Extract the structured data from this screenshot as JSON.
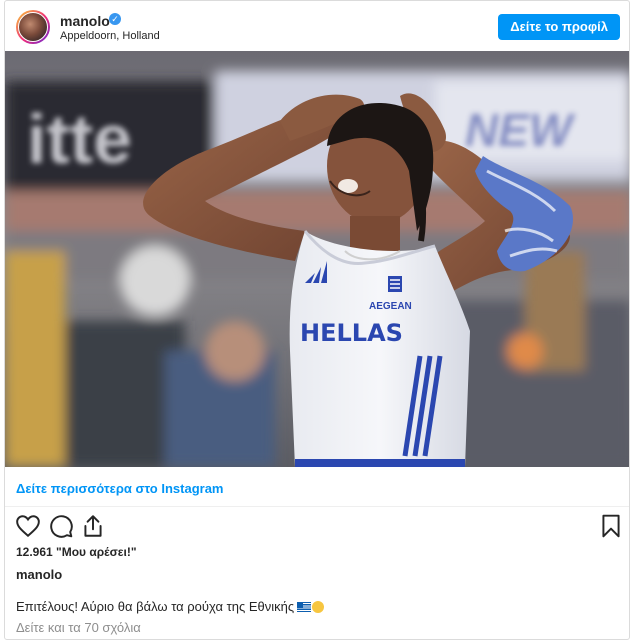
{
  "post": {
    "username": "manolo",
    "location": "Appeldoorn, Holland",
    "profile_button": "Δείτε το προφίλ",
    "see_more": "Δείτε περισσότερα στο Instagram",
    "likes": "12.961 \"Μου αρέσει!\"",
    "author": "manolo",
    "caption": "Επιτέλους! Αύριο θα βάλω τα ρούχα της Εθνικής",
    "comments_link": "Δείτε και τα 70 σχόλια"
  },
  "photo": {
    "jersey_text": "HELLAS",
    "sponsor_text": "AEGEAN",
    "banner_left": "itte",
    "banner_right": "NEW"
  },
  "icons": {
    "verified": "verified-badge-icon",
    "like": "heart-icon",
    "comment": "comment-icon",
    "share": "share-icon",
    "save": "bookmark-icon"
  },
  "colors": {
    "accent": "#0095f6",
    "text": "#262626",
    "muted": "#8e8e8e",
    "border": "#dbdbdb"
  }
}
